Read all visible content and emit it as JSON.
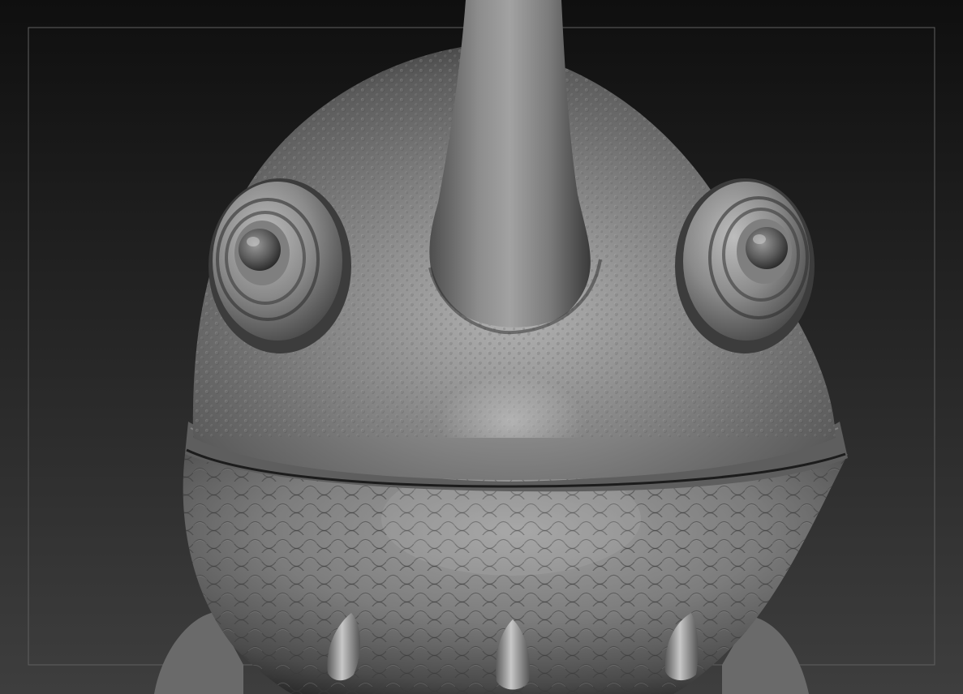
{
  "viewport": {
    "background_top": "#111111",
    "background_bottom": "#3c3c3c",
    "frame_color": "#5f5f5f"
  },
  "sculpt": {
    "subject": "creature-head-sculpt",
    "material_light": "#b4b4b4",
    "material_mid": "#7a7a7a",
    "material_dark": "#2e2e2e",
    "material_shadow": "#181818"
  }
}
